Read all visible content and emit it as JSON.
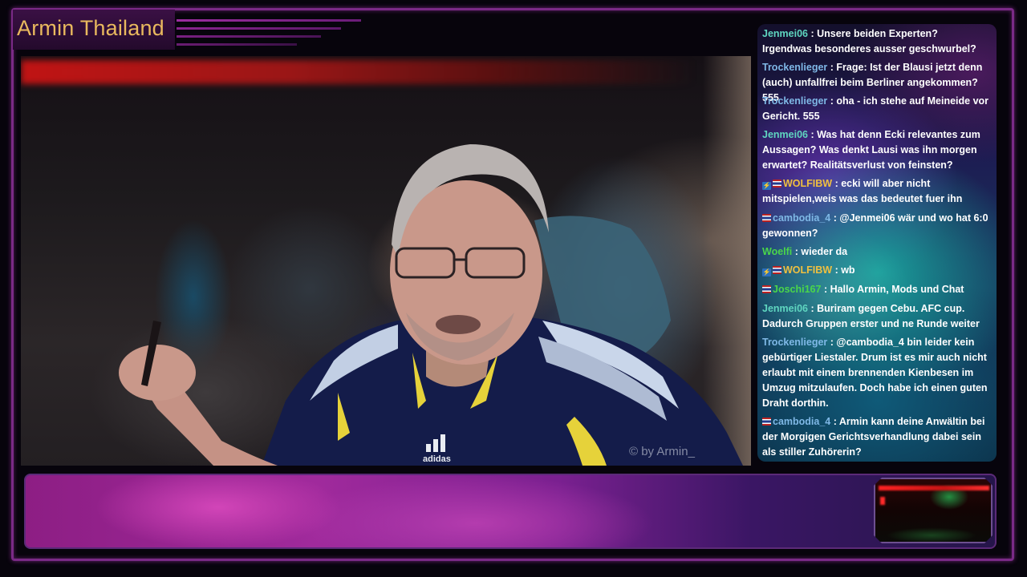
{
  "stream": {
    "title": "Armin Thailand",
    "watermark": "© by Armin_",
    "colors": {
      "title": "#e9b95e",
      "frame": "#7a2a86",
      "name_teal": "#5fd6c0",
      "name_blue": "#7fb8e6",
      "name_yellow": "#f0c040",
      "name_green": "#4ad64a"
    }
  },
  "chat": {
    "messages": [
      {
        "user": "Jenmei06",
        "text": " : Unsere beiden Experten? Irgendwas besonderes ausser geschwurbel?",
        "color": "#5fd6c0",
        "badges": []
      },
      {
        "user": "Trockenlieger",
        "text": " : Frage: Ist der Blausi jetzt denn (auch) unfallfrei beim Berliner angekommen? 555",
        "color": "#7fb8e6",
        "badges": []
      },
      {
        "user": "Trockenlieger",
        "text": " : oha - ich stehe auf Meineide vor Gericht. 555",
        "color": "#7fb8e6",
        "badges": []
      },
      {
        "user": "Jenmei06",
        "text": " : Was hat denn Ecki relevantes zum Aussagen? Was denkt Lausi was ihn morgen erwartet? Realitätsverlust von feinsten?",
        "color": "#5fd6c0",
        "badges": []
      },
      {
        "user": "WOLFIBW",
        "text": " : ecki will aber nicht mitspielen,weis was das bedeutet fuer ihn",
        "color": "#f0c040",
        "badges": [
          "moderator-badge",
          "thai-flag-badge"
        ]
      },
      {
        "user": "cambodia_4",
        "text": " : @Jenmei06 wär und wo hat 6:0 gewonnen?",
        "color": "#7fb8e6",
        "badges": [
          "thai-flag-badge"
        ]
      },
      {
        "user": "Woelfi",
        "text": " : wieder da",
        "color": "#4ad64a",
        "badges": []
      },
      {
        "user": "WOLFIBW",
        "text": " : wb",
        "color": "#f0c040",
        "badges": [
          "moderator-badge",
          "thai-flag-badge"
        ]
      },
      {
        "user": "Joschi167",
        "text": " : Hallo Armin, Mods und Chat",
        "color": "#4ad64a",
        "badges": [
          "thai-flag-badge"
        ]
      },
      {
        "user": "Jenmei06",
        "text": " : Buriram gegen Cebu. AFC cup. Dadurch Gruppen erster und ne Runde weiter",
        "color": "#5fd6c0",
        "badges": []
      },
      {
        "user": "Trockenlieger",
        "text": " : @cambodia_4 bin leider kein gebürtiger Liestaler. Drum ist es mir auch nicht erlaubt mit einem brennenden Kienbesen im Umzug mitzulaufen. Doch habe ich einen guten Draht dorthin.",
        "color": "#7fb8e6",
        "badges": []
      },
      {
        "user": "cambodia_4",
        "text": " : Armin kann deine Anwältin bei der Morgigen Gerichtsverhandlung dabei sein als stiller Zuhörerin?",
        "color": "#7fb8e6",
        "badges": [
          "thai-flag-badge"
        ]
      }
    ]
  }
}
